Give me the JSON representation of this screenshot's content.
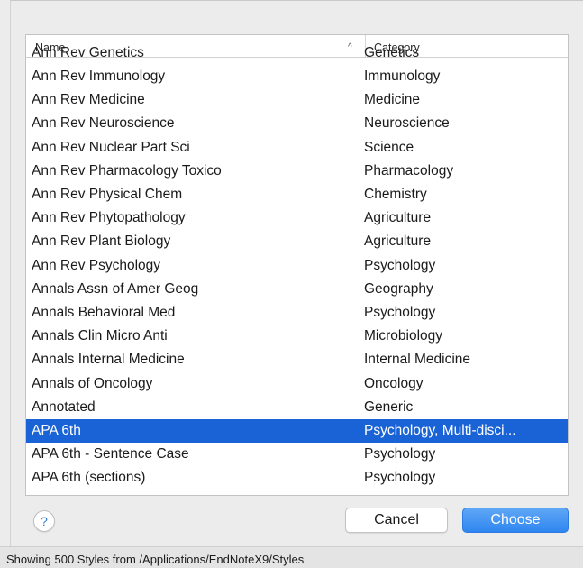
{
  "table": {
    "columns": {
      "name": "Name",
      "category": "Category"
    },
    "partial_row": {
      "name": "Ann Rev Genetics",
      "category": "Genetics"
    },
    "rows": [
      {
        "name": "Ann Rev Immunology",
        "category": "Immunology"
      },
      {
        "name": "Ann Rev Medicine",
        "category": "Medicine"
      },
      {
        "name": "Ann Rev Neuroscience",
        "category": "Neuroscience"
      },
      {
        "name": "Ann Rev Nuclear Part Sci",
        "category": "Science"
      },
      {
        "name": "Ann Rev Pharmacology Toxico",
        "category": "Pharmacology"
      },
      {
        "name": "Ann Rev Physical Chem",
        "category": "Chemistry"
      },
      {
        "name": "Ann Rev Phytopathology",
        "category": "Agriculture"
      },
      {
        "name": "Ann Rev Plant Biology",
        "category": "Agriculture"
      },
      {
        "name": "Ann Rev Psychology",
        "category": "Psychology"
      },
      {
        "name": "Annals Assn of Amer Geog",
        "category": "Geography"
      },
      {
        "name": "Annals Behavioral Med",
        "category": "Psychology"
      },
      {
        "name": "Annals Clin Micro Anti",
        "category": "Microbiology"
      },
      {
        "name": "Annals Internal Medicine",
        "category": "Internal Medicine"
      },
      {
        "name": "Annals of Oncology",
        "category": "Oncology"
      },
      {
        "name": "Annotated",
        "category": "Generic"
      },
      {
        "name": "APA 6th",
        "category": "Psychology, Multi-disci...",
        "selected": true
      },
      {
        "name": "APA 6th - Sentence Case",
        "category": "Psychology"
      },
      {
        "name": "APA 6th (sections)",
        "category": "Psychology"
      }
    ]
  },
  "buttons": {
    "help": "?",
    "cancel": "Cancel",
    "choose": "Choose"
  },
  "status": {
    "text": "Showing 500 Styles from /Applications/EndNoteX9/Styles"
  },
  "icons": {
    "sort": "chevron-up-icon"
  },
  "colors": {
    "selection": "#1a63d6",
    "accent": "#2f86f0"
  }
}
